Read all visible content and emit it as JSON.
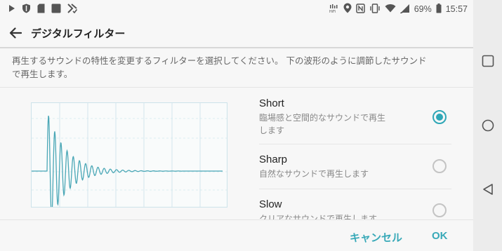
{
  "status_bar": {
    "battery_percent": "69%",
    "time": "15:57",
    "left_icons": [
      "play-icon",
      "shield-icon",
      "sd-card-icon",
      "square-icon",
      "signal-check-icon"
    ],
    "right_icons": [
      "hifi-icon",
      "location-icon",
      "nfc-icon",
      "vibrate-icon",
      "wifi-icon",
      "cell-signal-icon",
      "battery-icon"
    ]
  },
  "app_bar": {
    "title": "デジタルフィルター"
  },
  "description": "再生するサウンドの特性を変更するフィルターを選択してください。 下の波形のように調節したサウンドで再生します。",
  "options": [
    {
      "name": "Short",
      "desc": "臨場感と空間的なサウンドで再生します",
      "selected": true
    },
    {
      "name": "Sharp",
      "desc": "自然なサウンドで再生します",
      "selected": false
    },
    {
      "name": "Slow",
      "desc": "クリアなサウンドで再生します",
      "selected": false
    }
  ],
  "buttons": {
    "cancel": "キャンセル",
    "ok": "OK"
  },
  "colors": {
    "accent": "#2fa7b7",
    "waveform": "#4aa7b6"
  }
}
